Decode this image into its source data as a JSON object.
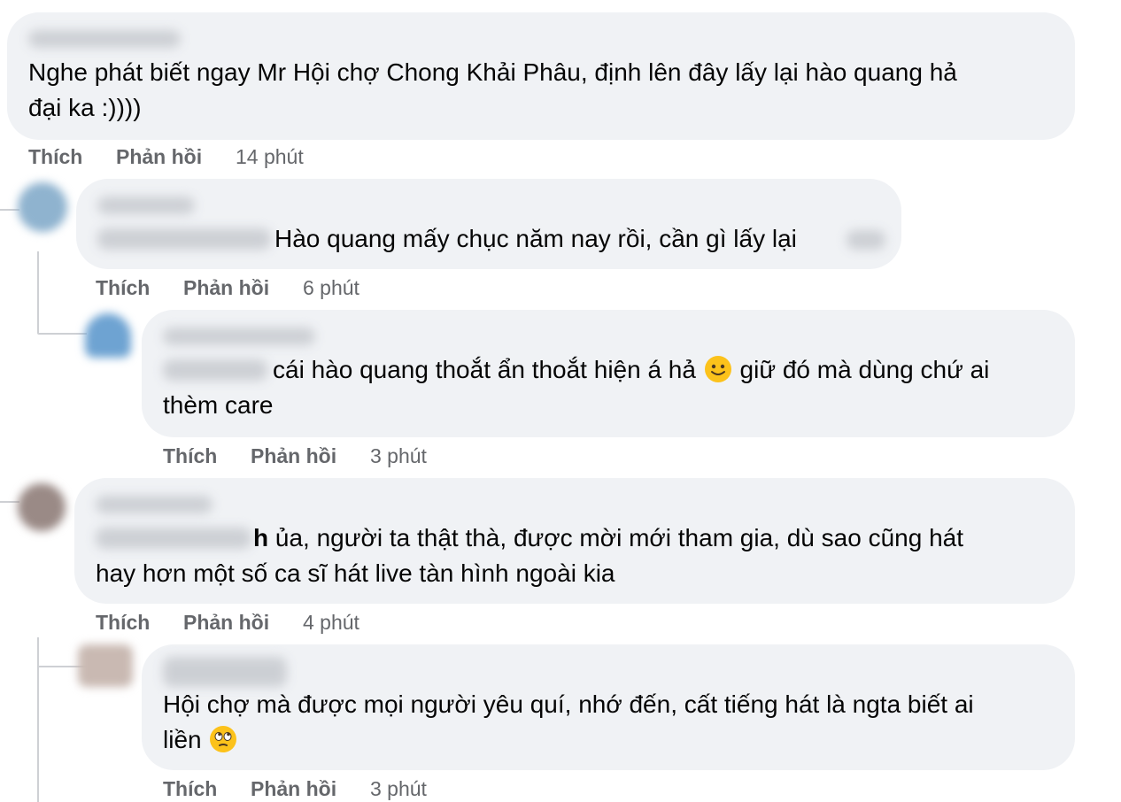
{
  "comments": [
    {
      "author": "Phạm Chí Hiếu",
      "text": "Nghe phát biết ngay Mr Hội chợ Chong Khải Phâu, định lên đây lấy lại hào quang hả đại ka :))))",
      "line1": "Nghe phát biết ngay Mr Hội chợ Chong Khải Phâu, định lên đây lấy lại hào quang hả",
      "line2": "đại ka :))))",
      "like": "Thích",
      "reply": "Phản hồi",
      "time": "14 phút"
    },
    {
      "author": "Xuân Hạ",
      "mention": "Phạm Chí Hiếu",
      "text": "Hào quang mấy chục năm nay rồi, cần gì lấy lại",
      "trailing_blur": "ma",
      "like": "Thích",
      "reply": "Phản hồi",
      "time": "6 phút"
    },
    {
      "author": "Phạm Chí Hiếu",
      "mention": "Xuân Hạ",
      "text_part1": "cái hào quang thoắt ẩn thoắt hiện á hả",
      "emoji1": "slightly-smiling-face",
      "text_part2": "giữ đó mà dùng chứ ai",
      "line2": "thèm care",
      "like": "Thích",
      "reply": "Phản hồi",
      "time": "3 phút"
    },
    {
      "author": "Diễm Trinh",
      "mention": "Phạm Chí Hiếu",
      "mention_tail": "h",
      "line1": "ủa, người ta thật thà, được mời mới tham gia, dù sao cũng hát",
      "line2": "hay hơn một số ca sĩ hát live tàn hình ngoài kia",
      "like": "Thích",
      "reply": "Phản hồi",
      "time": "4 phút"
    },
    {
      "author": "Thu Hà",
      "line1": "Hội chợ mà được mọi người yêu quí, nhớ đến, cất tiếng hát là ngta biết ai",
      "line2": "liền",
      "emoji2": "face-with-rolling-eyes",
      "like": "Thích",
      "reply": "Phản hồi",
      "time": "3 phút"
    }
  ],
  "colors": {
    "bubble": "#f0f2f5",
    "secondary_text": "#65676b",
    "thread_line": "#ced0d4",
    "emoji_yellow": "#fcc21b"
  }
}
